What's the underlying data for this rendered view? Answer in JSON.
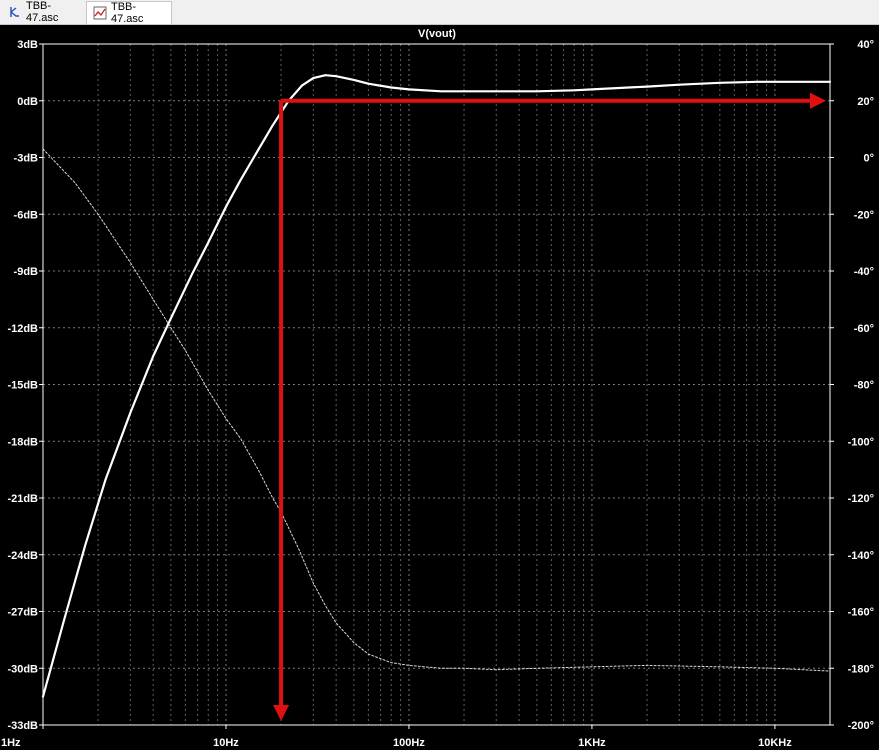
{
  "tabs": [
    {
      "label": "TBB-47.asc",
      "icon": "schematic-icon"
    },
    {
      "label": "TBB-47.asc",
      "icon": "waveform-icon"
    }
  ],
  "colors": {
    "background": "#000000",
    "trace": "#ffffff",
    "grid": "#7a7a7a",
    "annotation": "#e01010",
    "axis_text": "#ffffff"
  },
  "chart_data": {
    "type": "line",
    "title": "V(vout)",
    "x_scale": "log",
    "xlim": [
      1,
      20000
    ],
    "x_ticks": [
      1,
      10,
      100,
      1000,
      10000
    ],
    "x_tick_labels": [
      "1Hz",
      "10Hz",
      "100Hz",
      "1KHz",
      "10KHz"
    ],
    "y_left": {
      "unit": "dB",
      "lim": [
        -33,
        3
      ],
      "ticks": [
        3,
        0,
        -3,
        -6,
        -9,
        -12,
        -15,
        -18,
        -21,
        -24,
        -27,
        -30,
        -33
      ],
      "tick_labels": [
        "3dB",
        "0dB",
        "-3dB",
        "-6dB",
        "-9dB",
        "-12dB",
        "-15dB",
        "-18dB",
        "-21dB",
        "-24dB",
        "-27dB",
        "-30dB",
        "-33dB"
      ]
    },
    "y_right": {
      "unit": "°",
      "lim": [
        -200,
        40
      ],
      "ticks": [
        40,
        20,
        0,
        -20,
        -40,
        -60,
        -80,
        -100,
        -120,
        -140,
        -160,
        -180,
        -200
      ],
      "tick_labels": [
        "40°",
        "20°",
        "0°",
        "-20°",
        "-40°",
        "-60°",
        "-80°",
        "-100°",
        "-120°",
        "-140°",
        "-160°",
        "-180°",
        "-200°"
      ]
    },
    "grid": true,
    "series": [
      {
        "axis": "left",
        "style": "solid",
        "x": [
          1,
          1.3,
          1.7,
          2.2,
          3,
          4,
          5,
          6.5,
          8,
          10,
          12,
          15,
          18,
          22,
          26,
          30,
          35,
          40,
          50,
          60,
          80,
          100,
          150,
          200,
          300,
          500,
          800,
          1000,
          2000,
          3000,
          5000,
          8000,
          10000,
          20000
        ],
        "y": [
          -31.5,
          -27.5,
          -23.5,
          -20,
          -16.5,
          -13.5,
          -11.5,
          -9.2,
          -7.5,
          -5.6,
          -4.2,
          -2.6,
          -1.3,
          0.0,
          0.8,
          1.2,
          1.35,
          1.3,
          1.1,
          0.9,
          0.7,
          0.6,
          0.5,
          0.5,
          0.5,
          0.5,
          0.55,
          0.6,
          0.75,
          0.85,
          0.95,
          1.0,
          1.0,
          1.0
        ]
      },
      {
        "axis": "right",
        "style": "dashed",
        "x": [
          1,
          1.5,
          2,
          3,
          4,
          5,
          6,
          8,
          10,
          12,
          15,
          18,
          20,
          25,
          30,
          35,
          40,
          50,
          60,
          80,
          100,
          150,
          200,
          300,
          500,
          1000,
          2000,
          5000,
          10000,
          20000
        ],
        "y": [
          3,
          -9,
          -20,
          -37,
          -50,
          -60,
          -68,
          -82,
          -92,
          -99,
          -110,
          -120,
          -125,
          -138,
          -150,
          -158,
          -164,
          -171,
          -175,
          -178,
          -179,
          -180,
          -180,
          -180.5,
          -180,
          -179.5,
          -179,
          -179.5,
          -180,
          -181
        ]
      }
    ],
    "annotations": [
      {
        "type": "arrow",
        "from": {
          "x": 20,
          "y": 0
        },
        "to": {
          "x": 20000,
          "y": 0
        }
      },
      {
        "type": "arrow",
        "from": {
          "x": 20,
          "y": 0
        },
        "to": {
          "x": 20,
          "y": -33
        }
      }
    ]
  }
}
